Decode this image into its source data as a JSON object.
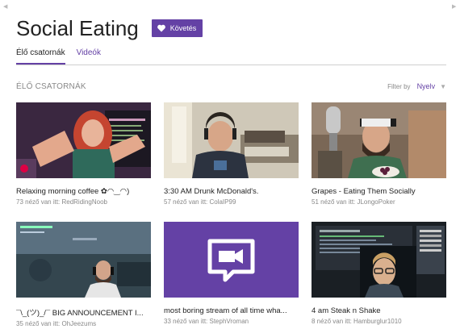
{
  "page_title": "Social Eating",
  "follow_label": "Követés",
  "tabs": [
    {
      "label": "Élő csatornák",
      "active": true
    },
    {
      "label": "Videók",
      "active": false
    }
  ],
  "section_label": "ÉLŐ CSATORNÁK",
  "filter": {
    "label": "Filter by",
    "value": "Nyelv"
  },
  "accent_color": "#6441a5",
  "streams": [
    {
      "title": "Relaxing morning coffee ✿◠‿◠)",
      "meta": "73 néző van itt: RedRidingNoob"
    },
    {
      "title": "3:30 AM Drunk McDonald's.",
      "meta": "57 néző van itt: ColaIP99"
    },
    {
      "title": "Grapes - Eating Them Socially",
      "meta": "51 néző van itt: JLongoPoker"
    },
    {
      "title": "¯\\_(ツ)_/¯ BIG ANNOUNCEMENT I...",
      "meta": "35 néző van itt: OhJeezums"
    },
    {
      "title": "most boring stream of all time wha...",
      "meta": "33 néző van itt: StephVroman"
    },
    {
      "title": "4 am Steak n Shake",
      "meta": "8 néző van itt: Hamburglur1010"
    }
  ]
}
